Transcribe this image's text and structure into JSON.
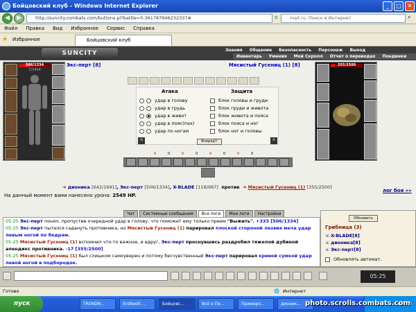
{
  "window": {
    "title": "Бойцовский клуб - Windows Internet Explorer"
  },
  "address": {
    "url": "http://suncity.combats.com/buttons.pl?battle=0.361787946232337#",
    "search_placeholder": "mail.ru: Поиск в Интернет"
  },
  "menu": [
    "Файл",
    "Правка",
    "Вид",
    "Избранное",
    "Сервис",
    "Справка"
  ],
  "favorites": {
    "label": "Избранное",
    "tab": "Бойцовский клуб"
  },
  "game": {
    "logo": "SUNCITY",
    "top_menu": [
      "Знания",
      "Общение",
      "Безопасность",
      "Персонаж",
      "Выход"
    ],
    "sub_menu": [
      "Инвентарь",
      "Умения",
      "Мой Скролл",
      "Отчет о переводах",
      "Поединки",
      "Анкета"
    ],
    "player": {
      "name": "Экс-перт [8]",
      "hp": "506/1334",
      "hp_fraction": 0.38,
      "mana": "17/434"
    },
    "enemy": {
      "name": "Мясистый Гусениц (1) [8]",
      "hp": "355/2500",
      "hp_fraction": 0.14
    },
    "attack": {
      "header": "Атака",
      "options": [
        "удар в голову",
        "удар в грудь",
        "удар в живот",
        "удар в пояс(пах)",
        "удар по ногам"
      ],
      "selected": 2
    },
    "defense": {
      "header": "Защита",
      "options": [
        "блок головы и груди",
        "блок груди и живота",
        "блок живота и пояса",
        "блок пояса и ног",
        "блок ног и головы"
      ]
    },
    "forward_button": "Вперед!!",
    "counters": [
      "0",
      "0",
      "0",
      "0",
      "0",
      "0",
      "0",
      "0"
    ],
    "fighters": {
      "allies": [
        {
          "name": "дионика",
          "hp": "[642/1691]"
        },
        {
          "name": "Экс-перт",
          "hp": "[506/1334]"
        },
        {
          "name": "X-BLADE",
          "hp": "[118/987]"
        }
      ],
      "versus": "против",
      "enemy": "Мясистый Гусениц (1)",
      "enemy_hp": "[355/2500]"
    },
    "log_link": "лог боя »»",
    "damage_label": "На данный момент вами нанесено урона:",
    "damage_value": "2549 HP.",
    "chat_tabs": [
      "Чат",
      "Системные сообщения",
      "Все логи",
      "Мои логи",
      "Настройки"
    ],
    "active_tab": 2,
    "log": [
      {
        "time": "05:25",
        "actor": "Экс-перт",
        "text": "понял, пропустив очередной удар в голову, что поможет ему только прием",
        "tail": "\"Выжить\".",
        "extra": "+333 [506/1334]"
      },
      {
        "time": "05:25",
        "actor": "Экс-перт",
        "text": "пытался садануть противника, но",
        "target": "Мясистый Гусениц (1)",
        "tail": "парировал",
        "extra": "плоской стороной лезвия меча удар левым ногой по бедрам."
      },
      {
        "time": "05:25",
        "actor": "Мясистый Гусениц (1)",
        "text": "вспомнил что-то важное, и вдруг,",
        "target": "Экс-перт",
        "tail": "проснувшись раздробил тяжелой дубиной апендикс противника.",
        "extra": "-17 [355/2500]"
      },
      {
        "time": "05:25",
        "actor": "Мясистый Гусениц (1)",
        "text": "был слишком самоуверен и потому бесчувственный",
        "target": "Экс-перт",
        "tail": "парировал",
        "extra": "кривой сумкой удар левой ногой в подбородок."
      }
    ],
    "side": {
      "refresh": "Обновить",
      "group": "Грибница (3)",
      "members": [
        "X-BLADE[8]",
        "дионика[8]",
        "Экс-перт[8]"
      ],
      "auto_label": "Обновлять автомат."
    }
  },
  "status": {
    "text": "Готово",
    "zone": "Интернет"
  },
  "taskbar": {
    "start": "пуск",
    "tasks": [
      "TRENDN...",
      "Endlwelt ...",
      "Бойцовс...",
      "Всё о По...",
      "Примеро...",
      "дионик..."
    ],
    "clock": "05:25"
  },
  "watermark": "photo.scrolls.combats.com"
}
